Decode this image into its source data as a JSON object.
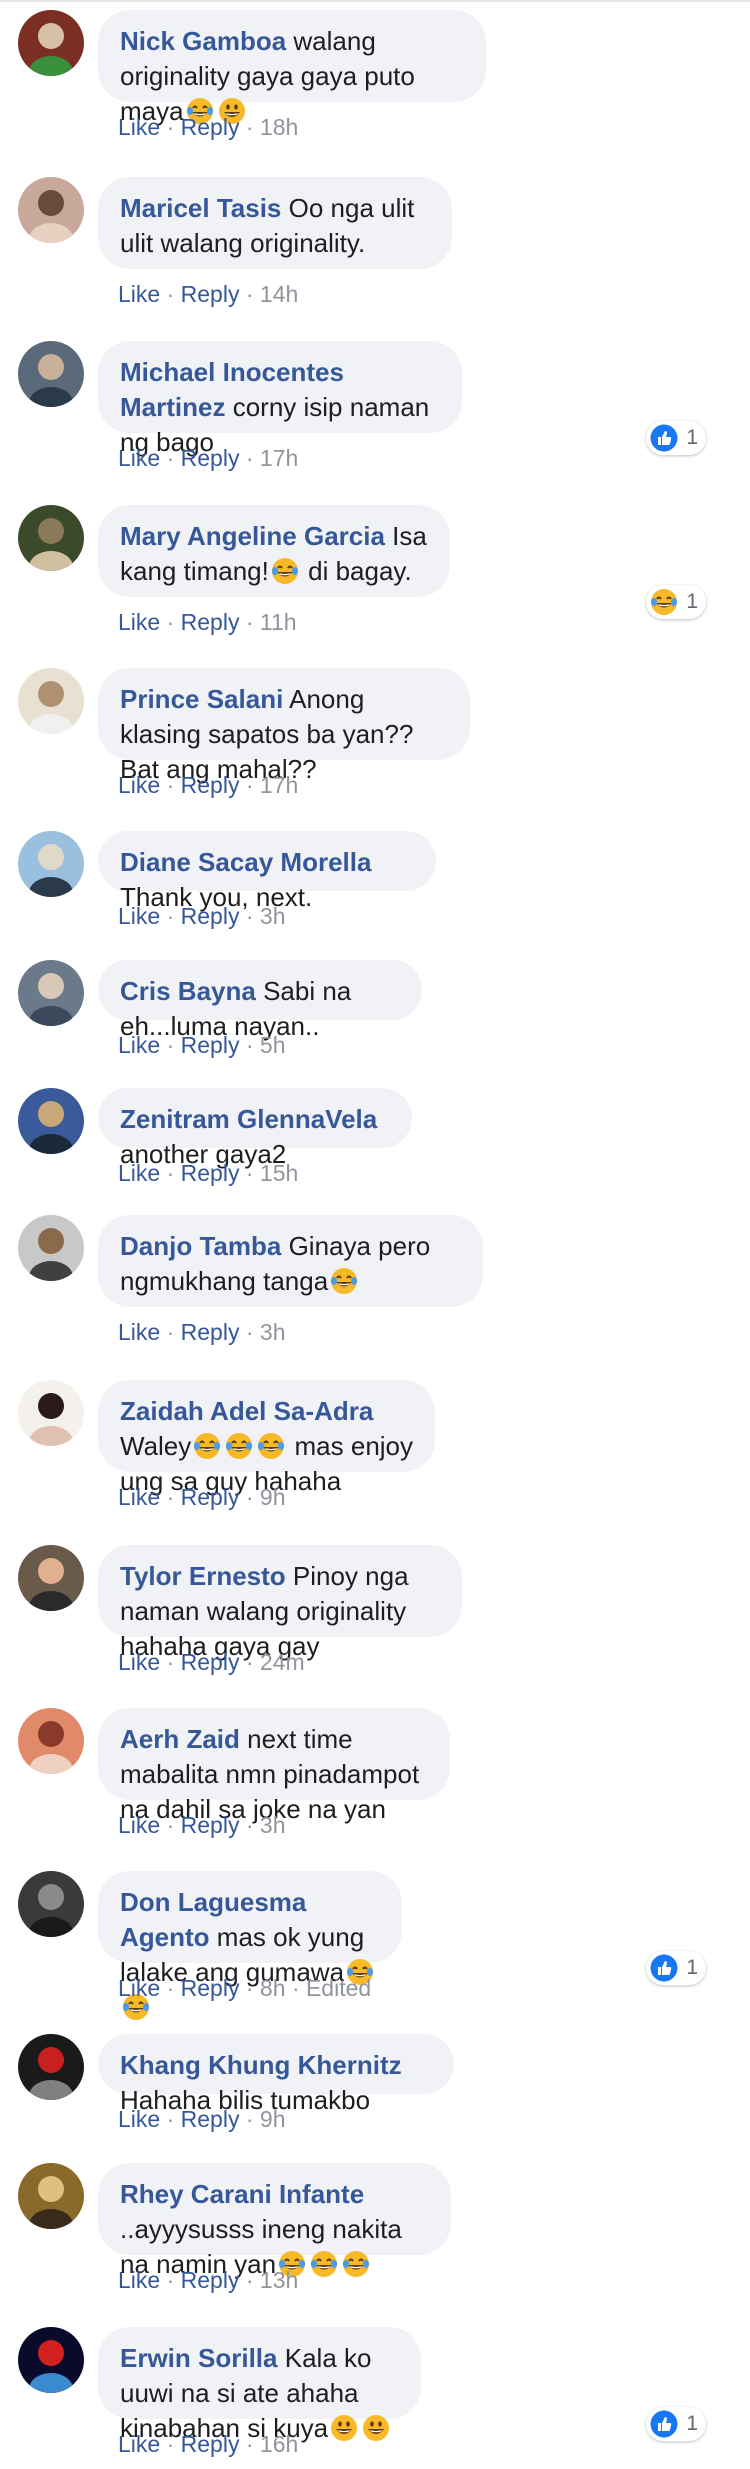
{
  "comments": [
    {
      "name": "Nick Gamboa",
      "text": "walang originality gaya gaya puto maya",
      "emoji": [
        "laugh",
        "grin"
      ],
      "time": "18h",
      "edited": "",
      "reaction": null
    },
    {
      "name": "Maricel Tasis",
      "text": "Oo nga ulit ulit walang originality.",
      "emoji": [],
      "time": "14h",
      "edited": "",
      "reaction": null
    },
    {
      "name": "Michael Inocentes Martinez",
      "text": "corny isip naman ng bago",
      "emoji": [],
      "time": "17h",
      "edited": "",
      "reaction": {
        "type": "like",
        "count": "1"
      }
    },
    {
      "name": "Mary Angeline Garcia",
      "text": "Isa kang timang!",
      "text2": "di bagay.",
      "emoji": [
        "laugh"
      ],
      "time": "11h",
      "edited": "",
      "reaction": {
        "type": "haha",
        "count": "1"
      }
    },
    {
      "name": "Prince Salani",
      "text": "Anong klasing sapatos ba yan?? Bat ang mahal??",
      "emoji": [],
      "time": "17h",
      "edited": "",
      "reaction": null
    },
    {
      "name": "Diane Sacay Morella",
      "text": "Thank you, next.",
      "emoji": [],
      "time": "3h",
      "edited": "",
      "reaction": null
    },
    {
      "name": "Cris Bayna",
      "text": "Sabi na eh...luma nayan..",
      "emoji": [],
      "time": "5h",
      "edited": "",
      "reaction": null
    },
    {
      "name": "Zenitram GlennaVela",
      "text": "another gaya2",
      "emoji": [],
      "time": "15h",
      "edited": "",
      "reaction": null
    },
    {
      "name": "Danjo Tamba",
      "text": "Ginaya pero ngmukhang tanga",
      "emoji": [
        "laugh"
      ],
      "time": "3h",
      "edited": "",
      "reaction": null
    },
    {
      "name": "Zaidah Adel Sa-Adra",
      "text": "Waley",
      "text2": "mas enjoy ung sa guy hahaha",
      "emoji": [
        "laugh",
        "laugh",
        "laugh"
      ],
      "time": "9h",
      "edited": "",
      "reaction": null
    },
    {
      "name": "Tylor Ernesto",
      "text": "Pinoy nga naman walang originality hahaha gaya gay",
      "emoji": [],
      "time": "24m",
      "edited": "",
      "reaction": null
    },
    {
      "name": "Aerh Zaid",
      "text": "next time mabalita nmn pinadampot na dahil sa joke na yan",
      "emoji": [],
      "time": "3h",
      "edited": "",
      "reaction": null
    },
    {
      "name": "Don Laguesma Agento",
      "text": "mas ok yung lalake ang gumawa",
      "emoji": [
        "laugh",
        "laugh"
      ],
      "time": "8h",
      "edited": "Edited",
      "reaction": {
        "type": "like",
        "count": "1"
      }
    },
    {
      "name": "Khang Khung Khernitz",
      "text": "Hahaha bilis tumakbo",
      "emoji": [],
      "time": "9h",
      "edited": "",
      "reaction": null
    },
    {
      "name": "Rhey Carani Infante",
      "text": "..ayyysusss ineng nakita na namin yan",
      "emoji": [
        "laugh",
        "laugh",
        "laugh"
      ],
      "time": "13h",
      "edited": "",
      "reaction": null
    },
    {
      "name": "Erwin Sorilla",
      "text": "Kala ko uuwi na si ate ahaha kinabahan si kuya",
      "emoji": [
        "grin",
        "grin"
      ],
      "time": "16h",
      "edited": "",
      "reaction": {
        "type": "like",
        "count": "1"
      }
    }
  ],
  "labels": {
    "like": "Like",
    "reply": "Reply",
    "separator": "·"
  },
  "colors": {
    "name": "#365899",
    "meta": "#90949c",
    "bubble": "#f0f2f5",
    "like_blue": "#1877f2",
    "emoji_yellow": "#f7b928"
  },
  "icons": {
    "laugh": "tears-of-joy-emoji",
    "grin": "grinning-emoji",
    "like": "thumbs-up-icon",
    "haha": "haha-reaction-icon"
  }
}
